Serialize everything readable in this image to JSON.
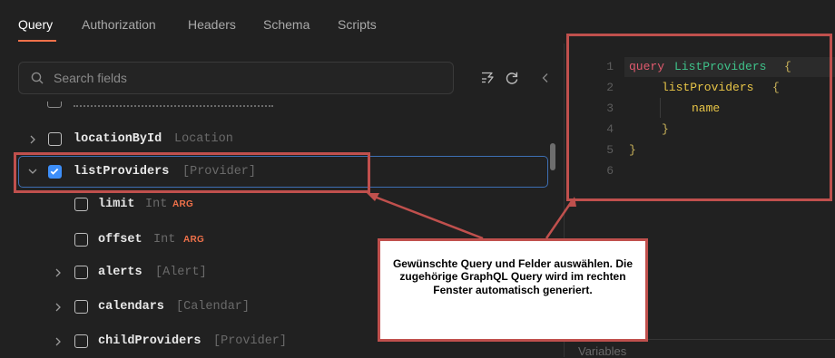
{
  "tabs": {
    "items": [
      {
        "label": "Query",
        "active": true
      },
      {
        "label": "Authorization",
        "active": false
      },
      {
        "label": "Headers",
        "active": false
      },
      {
        "label": "Schema",
        "active": false
      },
      {
        "label": "Scripts",
        "active": false
      }
    ]
  },
  "explorer": {
    "search_placeholder": "Search fields",
    "fields": [
      {
        "name": "locationById",
        "type": "Location",
        "expanded": false,
        "checked": false
      },
      {
        "name": "listProviders",
        "type": "[Provider]",
        "expanded": true,
        "checked": true
      },
      {
        "name": "limit",
        "type": "Int",
        "badge": "ARG",
        "checked": false
      },
      {
        "name": "offset",
        "type": "Int",
        "badge": "ARG",
        "checked": false
      },
      {
        "name": "alerts",
        "type": "[Alert]",
        "expanded": false,
        "checked": false
      },
      {
        "name": "calendars",
        "type": "[Calendar]",
        "expanded": false,
        "checked": false
      },
      {
        "name": "childProviders",
        "type": "[Provider]",
        "expanded": false,
        "checked": false
      }
    ]
  },
  "editor": {
    "line_numbers": [
      "1",
      "2",
      "3",
      "4",
      "5",
      "6"
    ],
    "keyword": "query",
    "operation_name": "ListProviders",
    "open_brace": "{",
    "field": "listProviders",
    "subfield": "name",
    "close_brace": "}"
  },
  "variables_label": "Variables",
  "annotation": {
    "text": "Gewünschte Query und Felder auswählen. Die zugehörige GraphQL Query wird im rechten Fenster automatisch generiert."
  },
  "colors": {
    "background": "#212121",
    "accent_tab": "#f0714a",
    "checkbox_checked": "#3d8ef8",
    "highlight_border": "#c0504d",
    "keyword": "#e05a6e",
    "operation_name": "#3fc28a",
    "field": "#e8c547",
    "brace": "#c9b25a"
  }
}
